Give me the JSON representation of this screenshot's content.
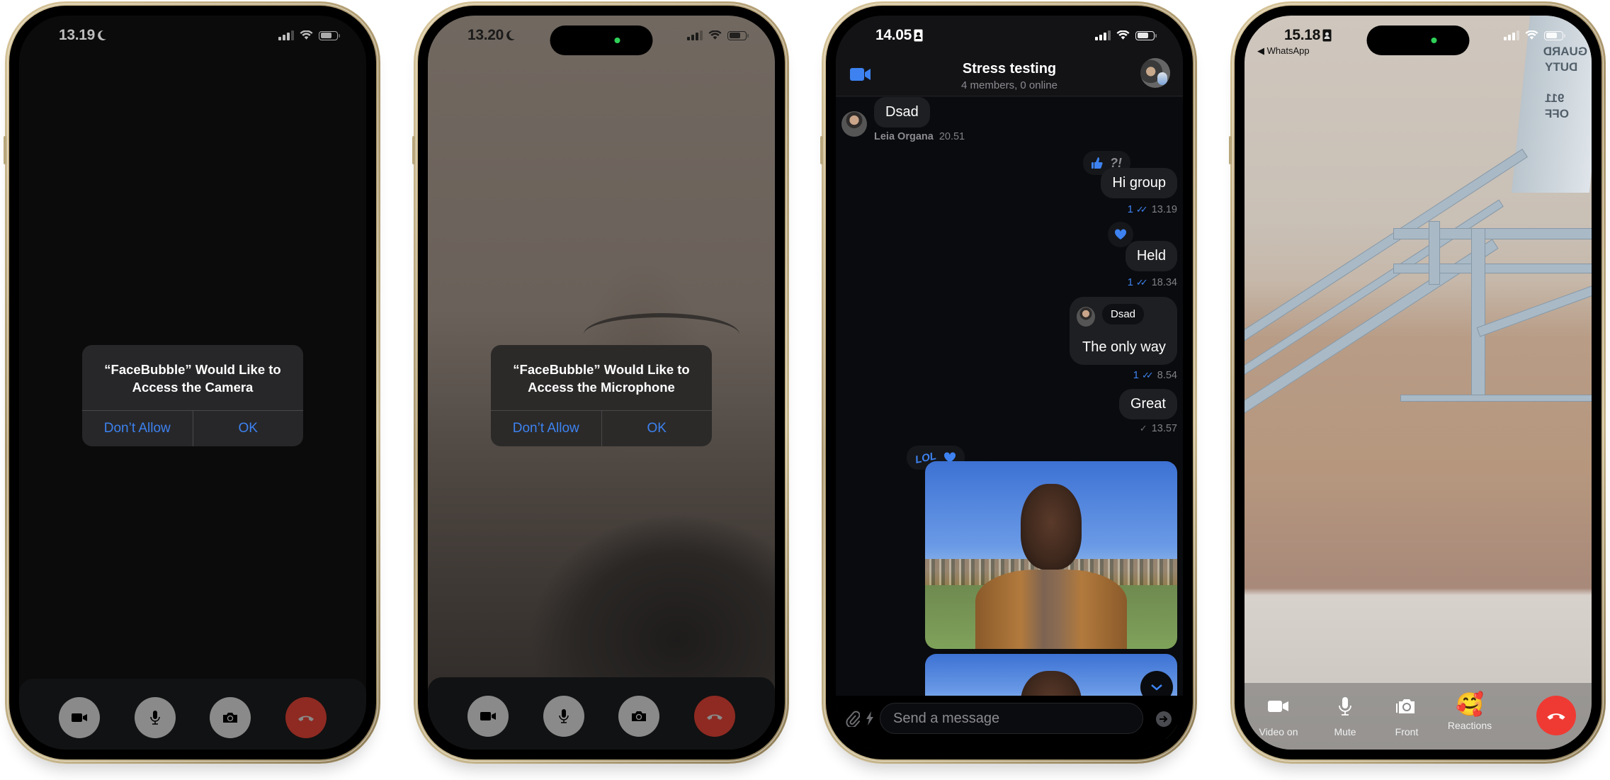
{
  "phones": [
    {
      "status": {
        "time": "13.19",
        "focus_icon": "moon-icon"
      },
      "alert": {
        "title": "“FaceBubble” Would Like to Access the Camera",
        "deny_label": "Don’t Allow",
        "ok_label": "OK"
      },
      "call_controls": [
        "video-camera-icon",
        "microphone-icon",
        "camera-flip-icon",
        "end-call-icon"
      ]
    },
    {
      "status": {
        "time": "13.20",
        "focus_icon": "moon-icon"
      },
      "alert": {
        "title": "“FaceBubble” Would Like to Access the Microphone",
        "deny_label": "Don’t Allow",
        "ok_label": "OK"
      },
      "call_controls": [
        "video-camera-icon",
        "microphone-icon",
        "camera-flip-icon",
        "end-call-icon"
      ]
    },
    {
      "status": {
        "time": "14.05",
        "focus_icon": "person-badge-icon"
      },
      "chat": {
        "title": "Stress testing",
        "subtitle": "4 members, 0 online",
        "messages": [
          {
            "sender": "Leia Organa",
            "text": "Dsad",
            "time": "20.51",
            "incoming": true
          },
          {
            "text": "Hi group",
            "reactions": [
              "thumbs-up-icon",
              "?!"
            ],
            "read_count": "1",
            "time": "13.19",
            "status": "read"
          },
          {
            "text": "Held",
            "reactions": [
              "heart-icon"
            ],
            "read_count": "1",
            "time": "18.34",
            "status": "read"
          },
          {
            "reply_to": "Dsad",
            "text": "The only way",
            "read_count": "1",
            "time": "8.54",
            "status": "read"
          },
          {
            "text": "Great",
            "time": "13.57",
            "status": "sent"
          },
          {
            "type": "photo",
            "reactions": [
              "LOL",
              "heart-icon"
            ]
          },
          {
            "type": "photo"
          }
        ],
        "composer_placeholder": "Send a message"
      }
    },
    {
      "status": {
        "time": "15.18",
        "focus_icon": "person-badge-icon",
        "back_label": "◀ WhatsApp"
      },
      "call_controls": [
        {
          "icon": "video-camera-icon",
          "label": "Video on"
        },
        {
          "icon": "microphone-icon",
          "label": "Mute"
        },
        {
          "icon": "camera-flip-icon",
          "label": "Front"
        },
        {
          "icon": "smiling-hearts-emoji",
          "label": "Reactions",
          "emoji": "🥰"
        },
        {
          "icon": "end-call-icon",
          "label": ""
        }
      ]
    }
  ],
  "colors": {
    "accent": "#3d82f0",
    "end_call_dim": "#8e2a22",
    "end_call": "#ef3a33",
    "dynamic_island_indicator": "#2fd158"
  }
}
